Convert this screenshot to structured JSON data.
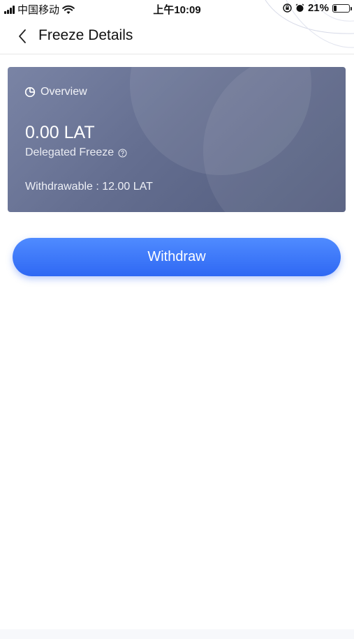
{
  "status_bar": {
    "carrier": "中国移动",
    "time": "上午10:09",
    "battery_percent": "21%",
    "battery_level": 0.21,
    "icons": [
      "signal-icon",
      "wifi-icon",
      "orientation-lock-icon",
      "alarm-icon",
      "battery-icon"
    ]
  },
  "nav": {
    "title": "Freeze Details",
    "back_icon": "chevron-left-icon"
  },
  "overview_card": {
    "header_label": "Overview",
    "header_icon": "pie-chart-icon",
    "amount": "0.00 LAT",
    "subtitle": "Delegated Freeze",
    "help_icon": "question-circle-icon",
    "withdrawable_text": "Withdrawable : 12.00 LAT",
    "colors": {
      "gradient_start": "#7a84a5",
      "gradient_end": "#515b7c"
    }
  },
  "actions": {
    "withdraw_label": "Withdraw",
    "button_color": "#3a74f8"
  }
}
